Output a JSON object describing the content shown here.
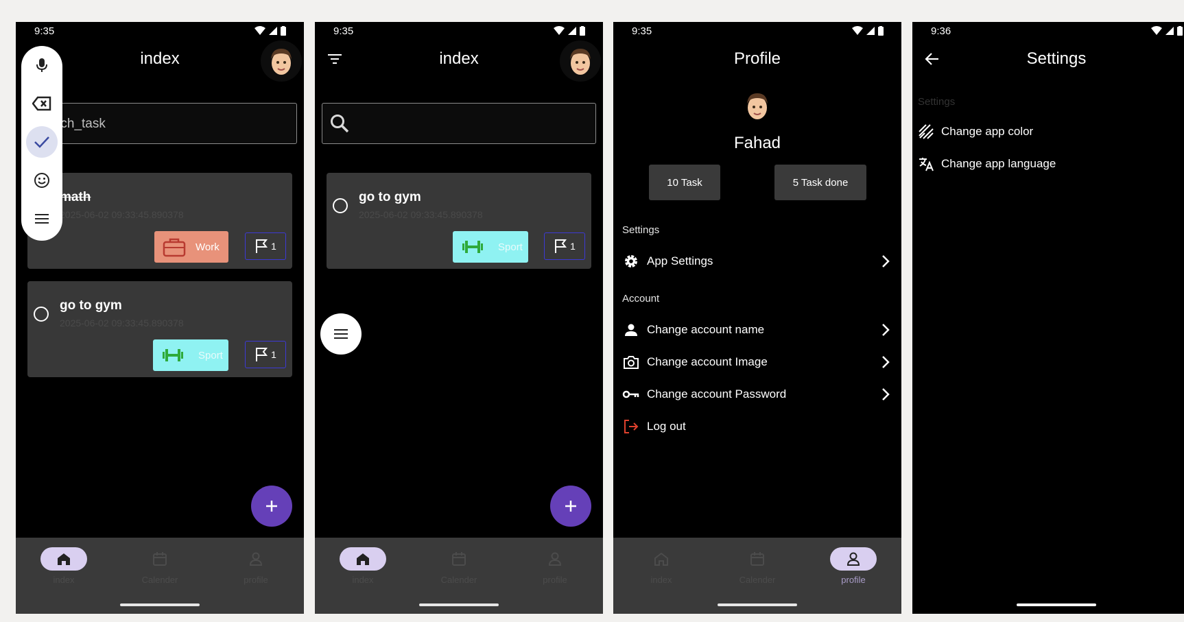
{
  "screens": [
    {
      "time": "9:35",
      "title": "index",
      "search_placeholder": "serch_task",
      "toolbar": [
        "microphone-icon",
        "backspace-icon",
        "check-icon",
        "emoji-icon",
        "menu-icon"
      ],
      "tasks": [
        {
          "name": "math",
          "date": "2025-06-02 09:33:45.890378",
          "category": "Work",
          "priority": "1",
          "done": true
        },
        {
          "name": "go to gym",
          "date": "2025-06-02 09:33:45.890378",
          "category": "Sport",
          "priority": "1",
          "done": false
        }
      ],
      "nav": [
        "index",
        "Calender",
        "profile"
      ],
      "active_nav": "index"
    },
    {
      "time": "9:35",
      "title": "index",
      "tasks": [
        {
          "name": "go to gym",
          "date": "2025-06-02 09:33:45.890378",
          "category": "Sport",
          "priority": "1",
          "done": false
        }
      ],
      "nav": [
        "index",
        "Calender",
        "profile"
      ],
      "active_nav": "index"
    },
    {
      "time": "9:35",
      "title": "Profile",
      "user_name": "Fahad",
      "stats": [
        "10 Task",
        "5 Task done"
      ],
      "settings_section": "Settings",
      "app_settings": "App Settings",
      "account_section": "Account",
      "account_items": [
        "Change account name",
        "Change account Image",
        "Change account Password"
      ],
      "logout": "Log out",
      "nav": [
        "index",
        "Calender",
        "profile"
      ],
      "active_nav": "profile"
    },
    {
      "time": "9:36",
      "title": "Settings",
      "section": "Settings",
      "items": [
        "Change app color",
        "Change app language"
      ]
    }
  ],
  "colors": {
    "accent": "#6540b8",
    "work": "#e8927a",
    "sport": "#8ff2f2",
    "nav_active": "#d9cff0",
    "logout": "#e0412d"
  }
}
